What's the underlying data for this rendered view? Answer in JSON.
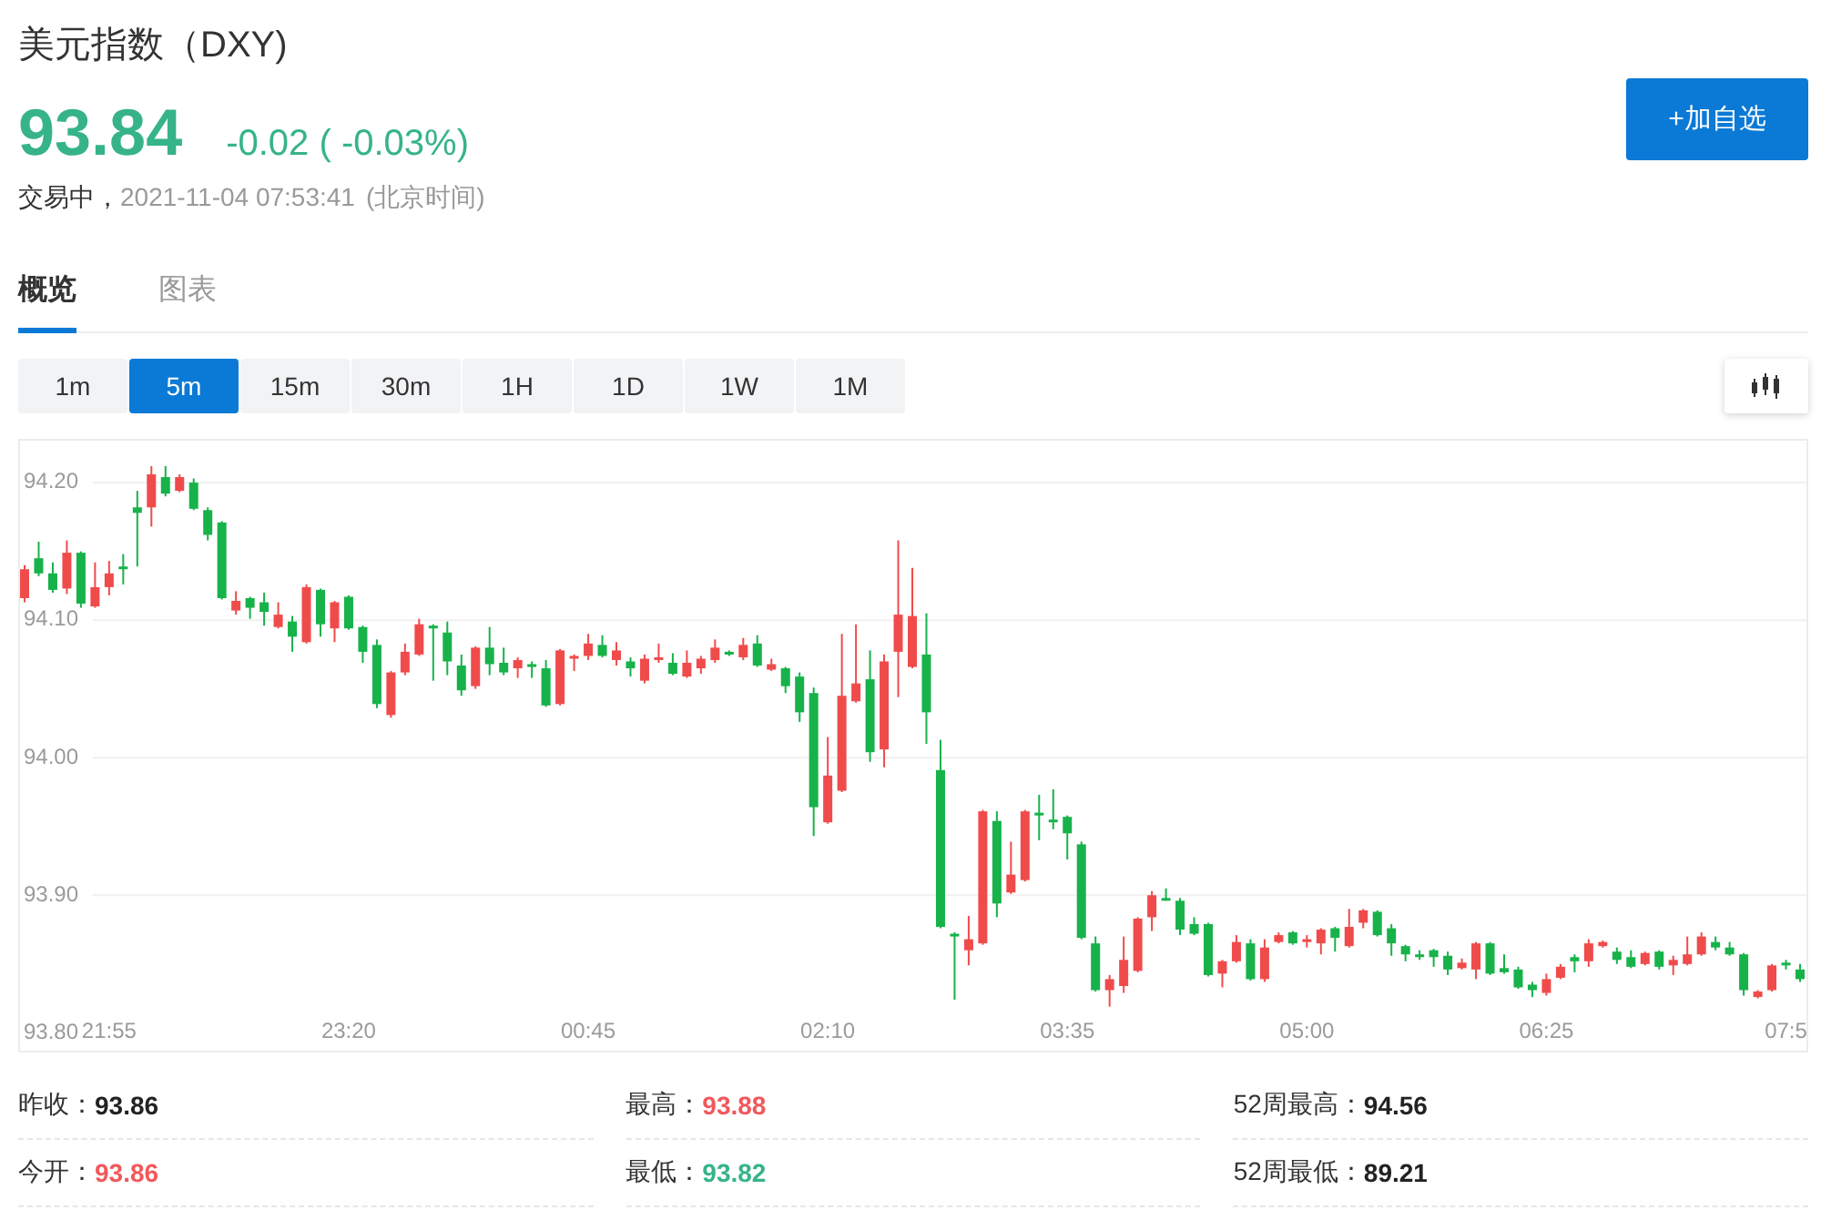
{
  "title": "美元指数（DXY)",
  "quote": {
    "price": "93.84",
    "change": "-0.02 ( -0.03%)",
    "color": "#36b38a"
  },
  "status": {
    "state": "交易中，",
    "timestamp": "2021-11-04 07:53:41",
    "timezone": "(北京时间)"
  },
  "watchlist_button": {
    "label": "+加自选"
  },
  "tabs": [
    {
      "label": "概览",
      "selected": true
    },
    {
      "label": "图表",
      "selected": false
    }
  ],
  "intervals": [
    {
      "label": "1m",
      "selected": false
    },
    {
      "label": "5m",
      "selected": true
    },
    {
      "label": "15m",
      "selected": false
    },
    {
      "label": "30m",
      "selected": false
    },
    {
      "label": "1H",
      "selected": false
    },
    {
      "label": "1D",
      "selected": false
    },
    {
      "label": "1W",
      "selected": false
    },
    {
      "label": "1M",
      "selected": false
    }
  ],
  "chart": {
    "chart_data": {
      "type": "candlestick",
      "categories": [
        null,
        null,
        null,
        null,
        null,
        null,
        "21:55",
        null,
        null,
        null,
        null,
        null,
        null,
        null,
        null,
        null,
        null,
        null,
        null,
        null,
        null,
        null,
        null,
        "23:20",
        null,
        null,
        null,
        null,
        null,
        null,
        null,
        null,
        null,
        null,
        null,
        null,
        null,
        null,
        null,
        null,
        "00:45",
        null,
        null,
        null,
        null,
        null,
        null,
        null,
        null,
        null,
        null,
        null,
        null,
        null,
        null,
        null,
        null,
        "02:10",
        null,
        null,
        null,
        null,
        null,
        null,
        null,
        null,
        null,
        null,
        null,
        null,
        null,
        null,
        null,
        null,
        "03:35",
        null,
        null,
        null,
        null,
        null,
        null,
        null,
        null,
        null,
        null,
        null,
        null,
        null,
        null,
        null,
        null,
        "05:00",
        null,
        null,
        null,
        null,
        null,
        null,
        null,
        null,
        null,
        null,
        null,
        null,
        null,
        null,
        null,
        null,
        "06:25",
        null,
        null,
        null,
        null,
        null,
        null,
        null,
        null,
        null,
        null,
        null,
        null,
        null,
        null,
        null,
        null,
        "07:5",
        null
      ],
      "ohlc": [
        [
          94.116,
          94.14,
          94.113,
          94.137
        ],
        [
          94.145,
          94.157,
          94.132,
          94.134
        ],
        [
          94.134,
          94.142,
          94.12,
          94.122
        ],
        [
          94.123,
          94.158,
          94.119,
          94.149
        ],
        [
          94.149,
          94.15,
          94.109,
          94.112
        ],
        [
          94.11,
          94.142,
          94.109,
          94.124
        ],
        [
          94.124,
          94.143,
          94.118,
          94.134
        ],
        [
          94.139,
          94.148,
          94.126,
          94.137
        ],
        [
          94.182,
          94.194,
          94.139,
          94.178
        ],
        [
          94.182,
          94.212,
          94.168,
          94.206
        ],
        [
          94.204,
          94.212,
          94.19,
          94.192
        ],
        [
          94.194,
          94.206,
          94.193,
          94.204
        ],
        [
          94.2,
          94.203,
          94.18,
          94.181
        ],
        [
          94.18,
          94.182,
          94.158,
          94.162
        ],
        [
          94.171,
          94.172,
          94.115,
          94.116
        ],
        [
          94.107,
          94.121,
          94.104,
          94.114
        ],
        [
          94.116,
          94.117,
          94.101,
          94.109
        ],
        [
          94.113,
          94.12,
          94.096,
          94.106
        ],
        [
          94.095,
          94.113,
          94.094,
          94.104
        ],
        [
          94.099,
          94.103,
          94.077,
          94.088
        ],
        [
          94.084,
          94.126,
          94.083,
          94.124
        ],
        [
          94.122,
          94.123,
          94.088,
          94.097
        ],
        [
          94.094,
          94.114,
          94.084,
          94.113
        ],
        [
          94.117,
          94.118,
          94.093,
          94.094
        ],
        [
          94.095,
          94.096,
          94.069,
          94.077
        ],
        [
          94.082,
          94.086,
          94.036,
          94.039
        ],
        [
          94.031,
          94.063,
          94.029,
          94.062
        ],
        [
          94.062,
          94.083,
          94.06,
          94.077
        ],
        [
          94.075,
          94.101,
          94.074,
          94.097
        ],
        [
          94.096,
          94.097,
          94.056,
          94.094
        ],
        [
          94.091,
          94.099,
          94.06,
          94.07
        ],
        [
          94.067,
          94.075,
          94.045,
          94.049
        ],
        [
          94.052,
          94.081,
          94.05,
          94.08
        ],
        [
          94.08,
          94.095,
          94.06,
          94.068
        ],
        [
          94.069,
          94.08,
          94.06,
          94.062
        ],
        [
          94.065,
          94.073,
          94.058,
          94.071
        ],
        [
          94.068,
          94.07,
          94.058,
          94.066
        ],
        [
          94.065,
          94.071,
          94.037,
          94.038
        ],
        [
          94.039,
          94.079,
          94.038,
          94.078
        ],
        [
          94.072,
          94.075,
          94.063,
          94.074
        ],
        [
          94.074,
          94.09,
          94.071,
          94.083
        ],
        [
          94.082,
          94.089,
          94.073,
          94.074
        ],
        [
          94.071,
          94.084,
          94.067,
          94.078
        ],
        [
          94.07,
          94.073,
          94.059,
          94.065
        ],
        [
          94.056,
          94.075,
          94.054,
          94.072
        ],
        [
          94.071,
          94.083,
          94.069,
          94.073
        ],
        [
          94.069,
          94.076,
          94.06,
          94.061
        ],
        [
          94.059,
          94.078,
          94.058,
          94.069
        ],
        [
          94.065,
          94.074,
          94.061,
          94.072
        ],
        [
          94.071,
          94.086,
          94.069,
          94.08
        ],
        [
          94.077,
          94.078,
          94.074,
          94.075
        ],
        [
          94.073,
          94.087,
          94.071,
          94.082
        ],
        [
          94.083,
          94.089,
          94.066,
          94.067
        ],
        [
          94.064,
          94.072,
          94.063,
          94.068
        ],
        [
          94.065,
          94.066,
          94.047,
          94.052
        ],
        [
          94.059,
          94.062,
          94.026,
          94.033
        ],
        [
          94.047,
          94.051,
          93.943,
          93.964
        ],
        [
          93.953,
          94.015,
          93.952,
          93.987
        ],
        [
          93.976,
          94.09,
          93.975,
          94.045
        ],
        [
          94.041,
          94.097,
          94.04,
          94.054
        ],
        [
          94.057,
          94.078,
          93.997,
          94.004
        ],
        [
          94.006,
          94.075,
          93.993,
          94.07
        ],
        [
          94.077,
          94.158,
          94.044,
          94.104
        ],
        [
          94.066,
          94.138,
          94.065,
          94.103
        ],
        [
          94.075,
          94.105,
          94.01,
          94.033
        ],
        [
          93.991,
          94.013,
          93.876,
          93.877
        ],
        [
          93.872,
          93.873,
          93.824,
          93.871
        ],
        [
          93.86,
          93.885,
          93.849,
          93.868
        ],
        [
          93.865,
          93.962,
          93.864,
          93.961
        ],
        [
          93.954,
          93.961,
          93.884,
          93.894
        ],
        [
          93.902,
          93.939,
          93.901,
          93.915
        ],
        [
          93.911,
          93.962,
          93.91,
          93.961
        ],
        [
          93.96,
          93.973,
          93.94,
          93.958
        ],
        [
          93.955,
          93.977,
          93.948,
          93.953
        ],
        [
          93.957,
          93.958,
          93.926,
          93.945
        ],
        [
          93.937,
          93.939,
          93.868,
          93.869
        ],
        [
          93.865,
          93.87,
          93.83,
          93.831
        ],
        [
          93.831,
          93.842,
          93.819,
          93.839
        ],
        [
          93.834,
          93.87,
          93.829,
          93.853
        ],
        [
          93.845,
          93.884,
          93.844,
          93.883
        ],
        [
          93.884,
          93.903,
          93.874,
          93.9
        ],
        [
          93.898,
          93.905,
          93.896,
          93.897
        ],
        [
          93.896,
          93.898,
          93.871,
          93.875
        ],
        [
          93.879,
          93.884,
          93.871,
          93.872
        ],
        [
          93.879,
          93.88,
          93.841,
          93.842
        ],
        [
          93.843,
          93.853,
          93.833,
          93.852
        ],
        [
          93.852,
          93.871,
          93.851,
          93.866
        ],
        [
          93.865,
          93.868,
          93.838,
          93.839
        ],
        [
          93.839,
          93.868,
          93.837,
          93.862
        ],
        [
          93.866,
          93.873,
          93.865,
          93.871
        ],
        [
          93.873,
          93.874,
          93.864,
          93.865
        ],
        [
          93.866,
          93.871,
          93.862,
          93.868
        ],
        [
          93.865,
          93.876,
          93.857,
          93.875
        ],
        [
          93.876,
          93.877,
          93.859,
          93.869
        ],
        [
          93.863,
          93.89,
          93.862,
          93.877
        ],
        [
          93.88,
          93.89,
          93.876,
          93.889
        ],
        [
          93.888,
          93.889,
          93.87,
          93.871
        ],
        [
          93.876,
          93.879,
          93.856,
          93.865
        ],
        [
          93.863,
          93.864,
          93.852,
          93.857
        ],
        [
          93.857,
          93.86,
          93.853,
          93.856
        ],
        [
          93.86,
          93.861,
          93.848,
          93.855
        ],
        [
          93.856,
          93.859,
          93.842,
          93.846
        ],
        [
          93.847,
          93.854,
          93.846,
          93.851
        ],
        [
          93.846,
          93.866,
          93.839,
          93.865
        ],
        [
          93.865,
          93.866,
          93.842,
          93.843
        ],
        [
          93.847,
          93.857,
          93.843,
          93.844
        ],
        [
          93.846,
          93.848,
          93.832,
          93.833
        ],
        [
          93.835,
          93.837,
          93.826,
          93.831
        ],
        [
          93.829,
          93.843,
          93.827,
          93.839
        ],
        [
          93.84,
          93.85,
          93.839,
          93.848
        ],
        [
          93.855,
          93.857,
          93.844,
          93.852
        ],
        [
          93.852,
          93.868,
          93.848,
          93.865
        ],
        [
          93.863,
          93.867,
          93.862,
          93.866
        ],
        [
          93.859,
          93.862,
          93.85,
          93.853
        ],
        [
          93.855,
          93.86,
          93.847,
          93.848
        ],
        [
          93.85,
          93.859,
          93.849,
          93.858
        ],
        [
          93.859,
          93.86,
          93.846,
          93.848
        ],
        [
          93.849,
          93.856,
          93.842,
          93.853
        ],
        [
          93.85,
          93.87,
          93.849,
          93.857
        ],
        [
          93.857,
          93.873,
          93.856,
          93.87
        ],
        [
          93.866,
          93.87,
          93.86,
          93.862
        ],
        [
          93.862,
          93.866,
          93.856,
          93.857
        ],
        [
          93.857,
          93.858,
          93.827,
          93.831
        ],
        [
          93.826,
          93.831,
          93.825,
          93.83
        ],
        [
          93.831,
          93.85,
          93.83,
          93.849
        ],
        [
          93.851,
          93.853,
          93.846,
          93.849
        ],
        [
          93.846,
          93.85,
          93.837,
          93.839
        ]
      ],
      "ylim": [
        93.787,
        94.2305
      ],
      "yticks": [
        {
          "value": 94.2,
          "label": "94.20"
        },
        {
          "value": 94.1,
          "label": "94.10"
        },
        {
          "value": 94.0,
          "label": "94.00"
        },
        {
          "value": 93.9,
          "label": "93.90"
        },
        {
          "value": 93.8,
          "label": "93.80"
        }
      ],
      "grid": true
    }
  },
  "stats": [
    {
      "label": "昨收：",
      "value": "93.86",
      "color": "#222222"
    },
    {
      "label": "最高：",
      "value": "93.88",
      "color": "#f2585b"
    },
    {
      "label": "52周最高：",
      "value": "94.56",
      "color": "#222222"
    },
    {
      "label": "今开：",
      "value": "93.86",
      "color": "#f2585b"
    },
    {
      "label": "最低：",
      "value": "93.82",
      "color": "#36b38a"
    },
    {
      "label": "52周最低：",
      "value": "89.21",
      "color": "#222222"
    }
  ]
}
